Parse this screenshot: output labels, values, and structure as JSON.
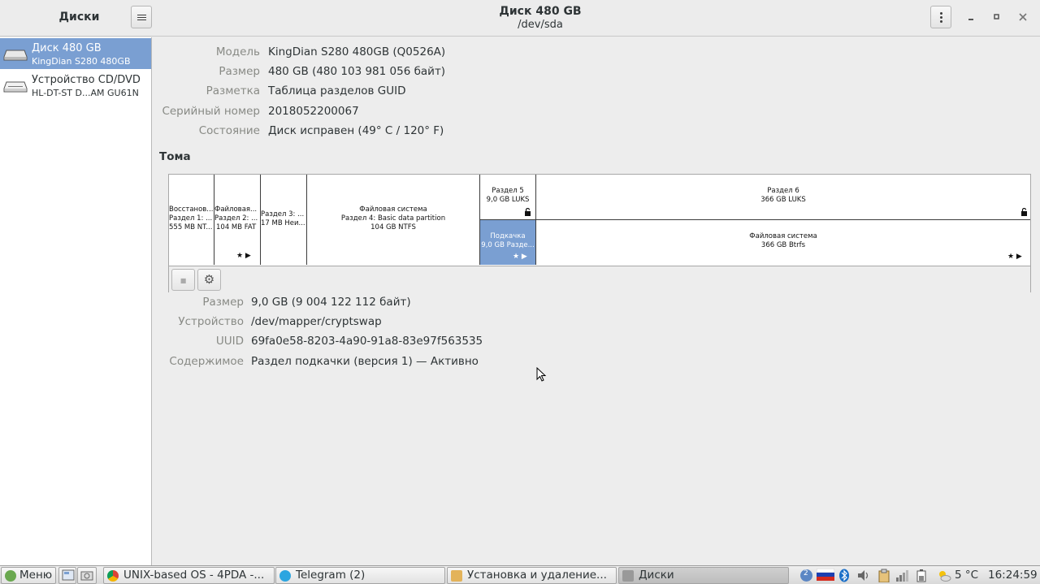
{
  "app": {
    "title": "Диски",
    "window_title": "Диск 480 GB",
    "window_subtitle": "/dev/sda"
  },
  "sidebar": {
    "items": [
      {
        "name": "Диск 480 GB",
        "detail": "KingDian S280 480GB",
        "selected": true,
        "icon": "hdd-icon"
      },
      {
        "name": "Устройство CD/DVD",
        "detail": "HL-DT-ST D...AM GU61N",
        "selected": false,
        "icon": "optical-drive-icon"
      }
    ]
  },
  "drive_props": [
    {
      "label": "Модель",
      "value": "KingDian S280 480GB (Q0526A)"
    },
    {
      "label": "Размер",
      "value": "480 GB (480 103 981 056 байт)"
    },
    {
      "label": "Разметка",
      "value": "Таблица разделов GUID"
    },
    {
      "label": "Серийный номер",
      "value": "2018052200067"
    },
    {
      "label": "Состояние",
      "value": "Диск исправен (49° C / 120° F)"
    }
  ],
  "volumes": {
    "title": "Тома",
    "partitions": [
      {
        "l1": "Восстанов...",
        "l2": "Раздел 1: ...",
        "l3": "555 MB NT..."
      },
      {
        "l1": "Файловая...",
        "l2": "Раздел 2: ...",
        "l3": "104 MB FAT"
      },
      {
        "l1": "Раздел 3: ...",
        "l2": "17 MB Неи..."
      },
      {
        "l1": "Файловая система",
        "l2": "Раздел 4: Basic data partition",
        "l3": "104 GB NTFS"
      },
      {
        "l1": "Раздел 5",
        "l2": "9,0 GB LUKS"
      },
      {
        "l1": "Раздел 6",
        "l2": "366 GB LUKS"
      }
    ],
    "inner": [
      {
        "l1": "Подкачка",
        "l2": "9,0 GB Разде..."
      },
      {
        "l1": "Файловая система",
        "l2": "366 GB Btrfs"
      }
    ],
    "glyph_star_play": "★ ▶",
    "glyph_lock": "🔓",
    "toolbar": {
      "stop_glyph": "■",
      "gears_glyph": "⚙"
    }
  },
  "volume_props": [
    {
      "label": "Размер",
      "value": "9,0 GB (9 004 122 112 байт)"
    },
    {
      "label": "Устройство",
      "value": "/dev/mapper/cryptswap"
    },
    {
      "label": "UUID",
      "value": "69fa0e58-8203-4a90-91a8-83e97f563535"
    },
    {
      "label": "Содержимое",
      "value": "Раздел подкачки (версия 1) — Активно"
    }
  ],
  "taskbar": {
    "menu": "Меню",
    "tasks": [
      {
        "label": "UNIX-based OS - 4PDA -...",
        "icon": "chrome-icon"
      },
      {
        "label": "Telegram (2)",
        "icon": "telegram-icon"
      },
      {
        "label": "Установка и удаление...",
        "icon": "package-icon"
      },
      {
        "label": "Диски",
        "icon": "disks-icon",
        "active": true
      }
    ],
    "weather": "5 °C",
    "clock": "16:24:59",
    "tray_badge": "2"
  },
  "colors": {
    "selection": "#7a9fd2",
    "accent": "#7a9fd2"
  }
}
